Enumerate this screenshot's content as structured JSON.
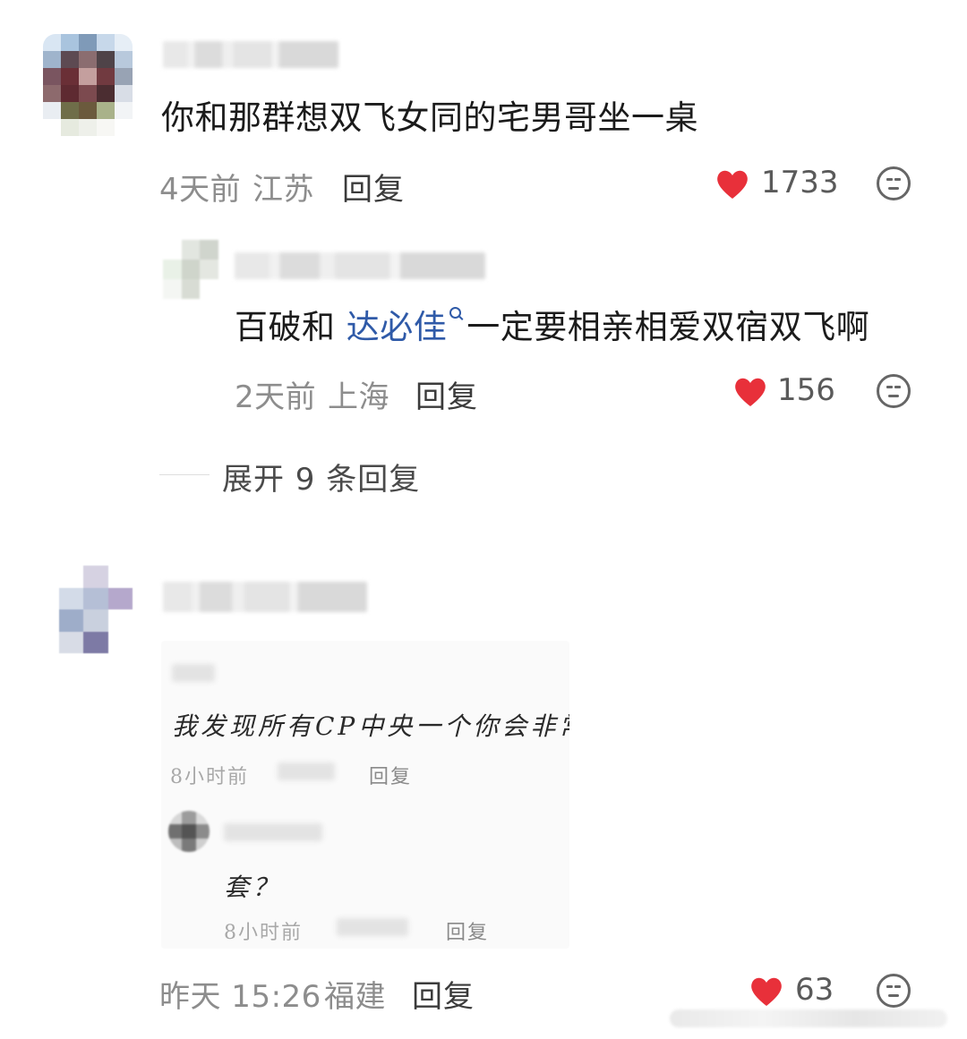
{
  "comments": [
    {
      "text": "你和那群想双飞女同的宅男哥坐一桌",
      "time": "4天前",
      "location": "江苏",
      "reply_label": "回复",
      "likes": "1733"
    },
    {
      "reply": {
        "text_before": "百破和",
        "mention": "达必佳",
        "text_after": "一定要相亲相爱双宿双飞啊",
        "time": "2天前",
        "location": "上海",
        "reply_label": "回复",
        "likes": "156"
      }
    },
    {
      "expand_label": "展开 9 条回复"
    },
    {
      "embedded_screenshot": {
        "comment_text": "我发现所有CP中央一个你会非常",
        "time": "8小时前",
        "reply_label": "回复",
        "sub_reply_text": "套？",
        "sub_reply_time": "8小时前",
        "sub_reply_label": "回复"
      },
      "time": "昨天 15:26",
      "location": "福建",
      "reply_label": "回复",
      "likes": "63"
    }
  ],
  "colors": {
    "like_heart": "#e8303a",
    "mention": "#2f5aa8",
    "meta_gray": "#8d8d8d"
  },
  "icons": [
    "heart-icon",
    "emoji-reaction-icon",
    "search-glyph-icon"
  ]
}
